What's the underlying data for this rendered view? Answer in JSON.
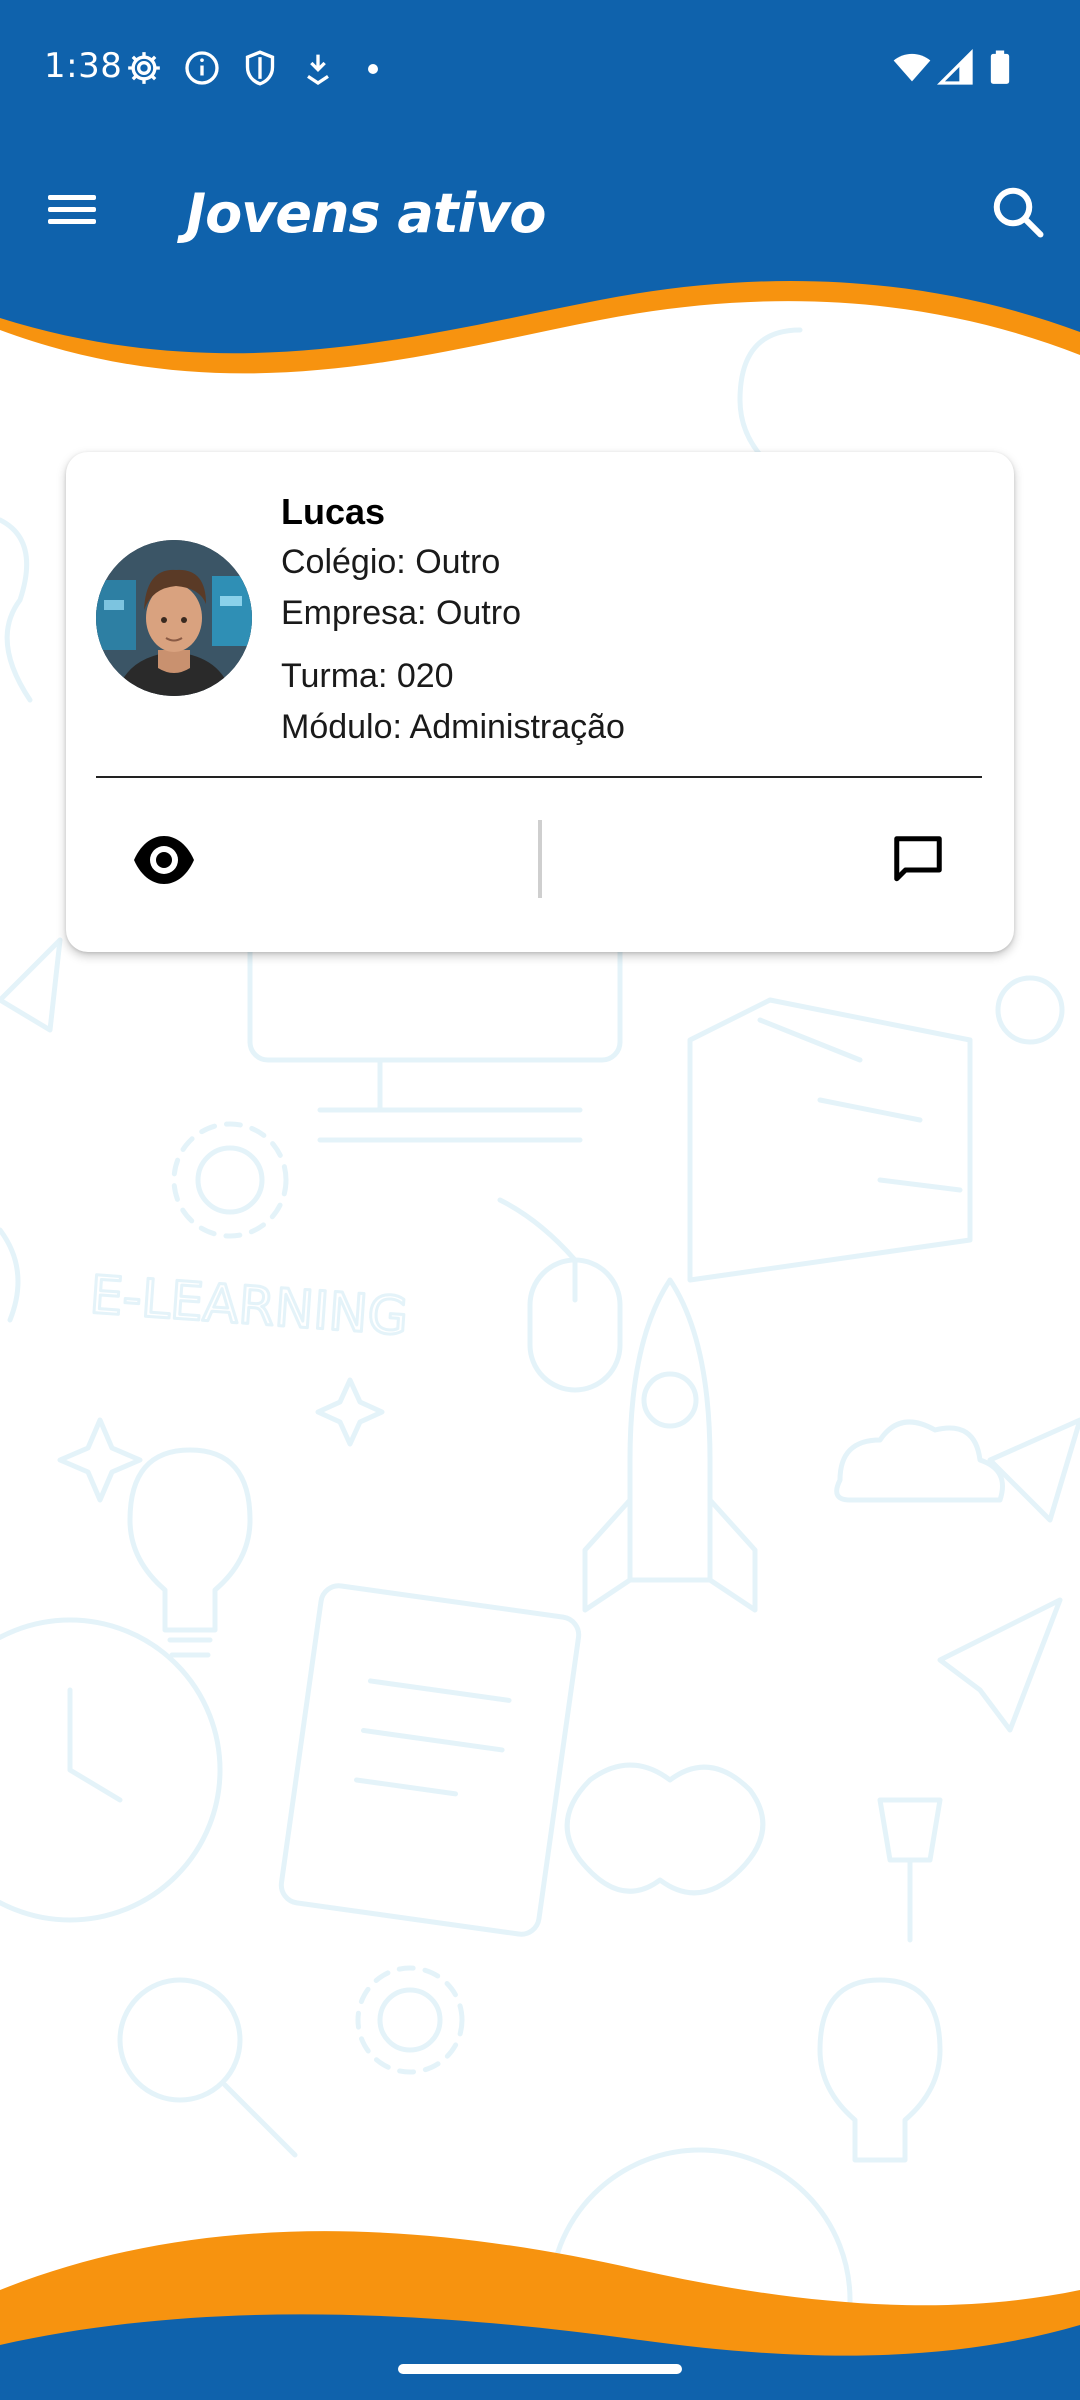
{
  "status_bar": {
    "time": "1:38",
    "icons": [
      "settings-icon",
      "info-icon",
      "shield-icon",
      "download-icon",
      "notification-dot",
      "wifi-icon",
      "signal-icon",
      "battery-icon"
    ]
  },
  "app_bar": {
    "title": "Jovens ativo",
    "menu_icon": "hamburger-menu-icon",
    "search_icon": "search-icon"
  },
  "colors": {
    "primary_blue": "#0f62ac",
    "accent_orange": "#f7930f",
    "background": "#ffffff",
    "doodle": "#e6f4fa"
  },
  "student_card": {
    "name": "Lucas",
    "school": "Colégio: Outro",
    "company": "Empresa: Outro",
    "class": "Turma: 020",
    "module": "Módulo: Administração",
    "actions": {
      "view_icon": "eye-icon",
      "message_icon": "chat-bubble-icon"
    }
  },
  "background_doodle": {
    "text": "E-LEARNING"
  }
}
